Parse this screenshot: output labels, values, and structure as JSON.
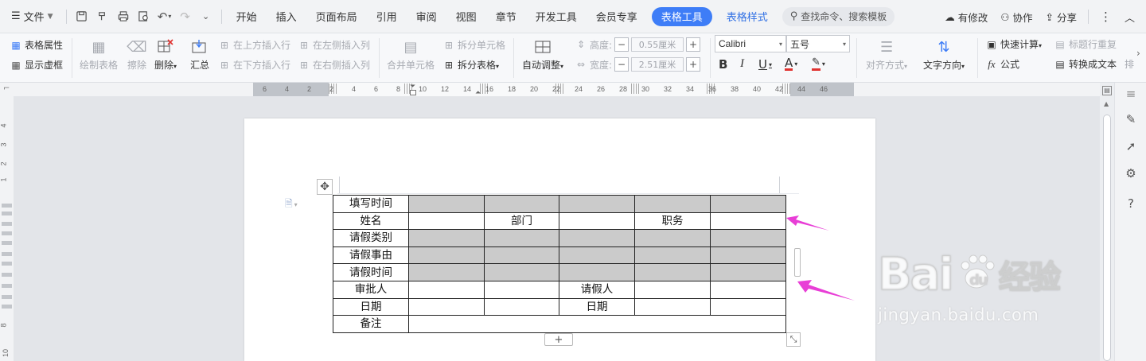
{
  "menubar": {
    "file_label": "文件",
    "tabs": [
      "开始",
      "插入",
      "页面布局",
      "引用",
      "审阅",
      "视图",
      "章节",
      "开发工具",
      "会员专享"
    ],
    "active_tab": "表格工具",
    "context_tab": "表格样式",
    "search_placeholder": "查找命令、搜索模板",
    "modified_label": "有修改",
    "collab_label": "协作",
    "share_label": "分享"
  },
  "ribbon": {
    "table_props": "表格属性",
    "show_gridlines": "显示虚框",
    "draw_table": "绘制表格",
    "erase": "擦除",
    "delete": "删除",
    "summary": "汇总",
    "insert_above": "在上方插入行",
    "insert_below": "在下方插入行",
    "insert_left": "在左侧插入列",
    "insert_right": "在右侧插入列",
    "merge_cells": "合并单元格",
    "split_cells": "拆分单元格",
    "split_table": "拆分表格",
    "autofit": "自动调整",
    "height_label": "高度:",
    "height_value": "0.55厘米",
    "width_label": "宽度:",
    "width_value": "2.51厘米",
    "font_name": "Calibri",
    "font_size": "五号",
    "align": "对齐方式",
    "text_direction": "文字方向",
    "quick_calc": "快速计算",
    "formula": "公式",
    "repeat_header": "标题行重复",
    "convert_text": "转换成文本",
    "sort": "排"
  },
  "ruler": {
    "h_ticks": [
      "6",
      "4",
      "2",
      "2",
      "4",
      "6",
      "8",
      "10",
      "12",
      "14",
      "16",
      "18",
      "20",
      "22",
      "24",
      "26",
      "28",
      "30",
      "32",
      "34",
      "36",
      "38",
      "40",
      "42",
      "44",
      "46"
    ],
    "v_ticks": [
      "4",
      "3",
      "2",
      "1",
      "8",
      "10"
    ]
  },
  "table": {
    "rows": [
      [
        {
          "t": "填写时间",
          "g": false
        },
        {
          "t": "",
          "g": true
        },
        {
          "t": "",
          "g": true
        },
        {
          "t": "",
          "g": true
        },
        {
          "t": "",
          "g": true
        },
        {
          "t": "",
          "g": true
        }
      ],
      [
        {
          "t": "姓名",
          "g": false
        },
        {
          "t": "",
          "g": false
        },
        {
          "t": "部门",
          "g": false
        },
        {
          "t": "",
          "g": false
        },
        {
          "t": "职务",
          "g": false
        },
        {
          "t": "",
          "g": false
        }
      ],
      [
        {
          "t": "请假类别",
          "g": false
        },
        {
          "t": "",
          "g": true
        },
        {
          "t": "",
          "g": true
        },
        {
          "t": "",
          "g": true
        },
        {
          "t": "",
          "g": true
        },
        {
          "t": "",
          "g": true
        }
      ],
      [
        {
          "t": "请假事由",
          "g": false
        },
        {
          "t": "",
          "g": true
        },
        {
          "t": "",
          "g": true
        },
        {
          "t": "",
          "g": true
        },
        {
          "t": "",
          "g": true
        },
        {
          "t": "",
          "g": true
        }
      ],
      [
        {
          "t": "请假时间",
          "g": false
        },
        {
          "t": "",
          "g": true
        },
        {
          "t": "",
          "g": true
        },
        {
          "t": "",
          "g": true
        },
        {
          "t": "",
          "g": true
        },
        {
          "t": "",
          "g": true
        }
      ],
      [
        {
          "t": "审批人",
          "g": false
        },
        {
          "t": "",
          "g": false
        },
        {
          "t": "",
          "g": false
        },
        {
          "t": "请假人",
          "g": false
        },
        {
          "t": "",
          "g": false
        },
        {
          "t": "",
          "g": false
        }
      ],
      [
        {
          "t": "日期",
          "g": false
        },
        {
          "t": "",
          "g": false
        },
        {
          "t": "",
          "g": false
        },
        {
          "t": "日期",
          "g": false
        },
        {
          "t": "",
          "g": false
        },
        {
          "t": "",
          "g": false
        }
      ]
    ],
    "last_row_label": "备注",
    "gray_fill": "#cbcbcb"
  },
  "watermark": {
    "logo": "Bai du 经验",
    "sub": "jingyan.baidu.com"
  },
  "colors": {
    "accent": "#3e7df7",
    "arrow": "#e83ed6"
  }
}
